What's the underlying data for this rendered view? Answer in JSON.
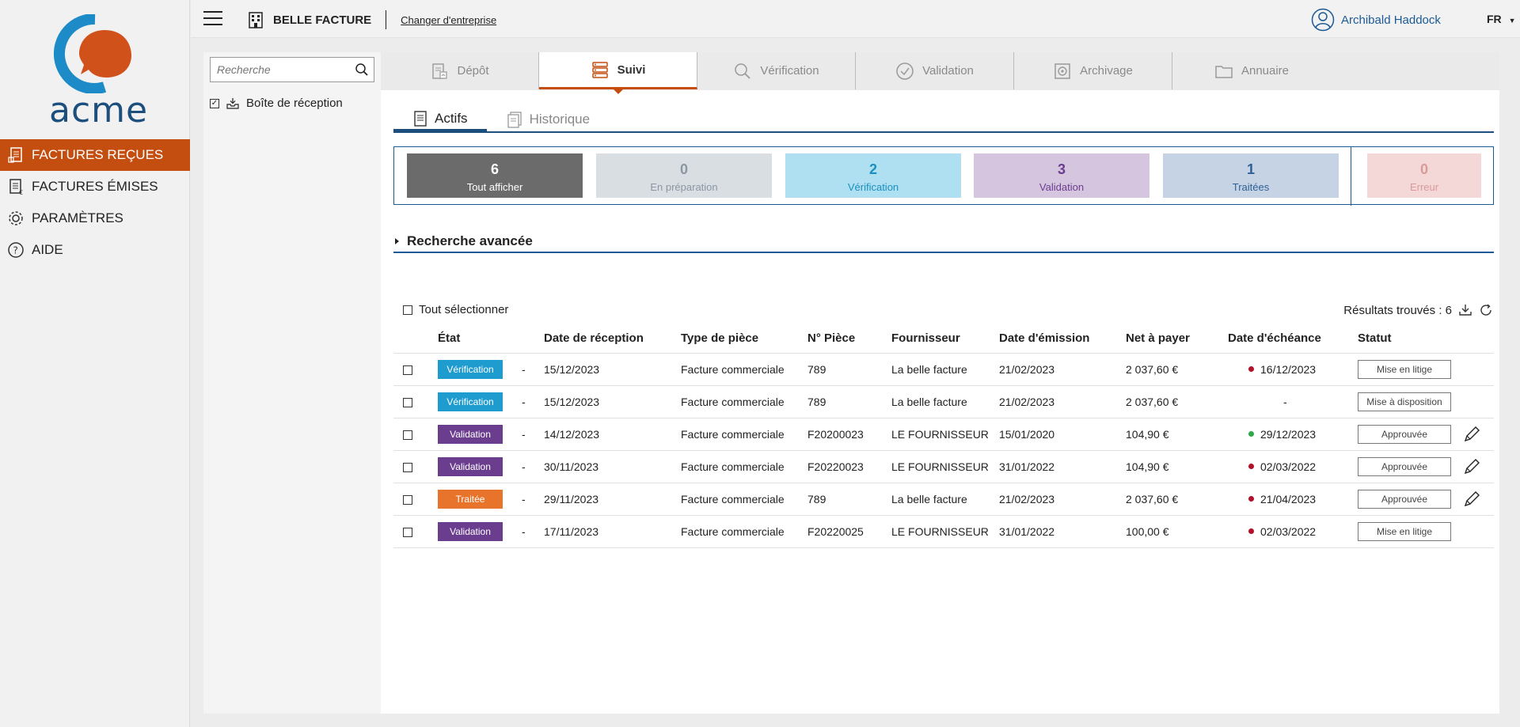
{
  "brand": {
    "logo_text": "acme"
  },
  "nav": {
    "items": [
      {
        "label": "FACTURES REÇUES",
        "icon": "invoice-received-icon",
        "active": true
      },
      {
        "label": "FACTURES ÉMISES",
        "icon": "invoice-sent-icon",
        "active": false
      },
      {
        "label": "PARAMÈTRES",
        "icon": "gear-icon",
        "active": false
      },
      {
        "label": "AIDE",
        "icon": "help-icon",
        "active": false
      }
    ]
  },
  "topbar": {
    "company": "BELLE FACTURE",
    "change_company": "Changer d'entreprise",
    "user": "Archibald Haddock",
    "lang": "FR"
  },
  "sidepanel": {
    "search_placeholder": "Recherche",
    "inbox_label": "Boîte de réception"
  },
  "main_tabs": [
    {
      "label": "Dépôt",
      "icon": "upload-doc-icon"
    },
    {
      "label": "Suivi",
      "icon": "list-icon",
      "active": true
    },
    {
      "label": "Vérification",
      "icon": "magnifier-icon"
    },
    {
      "label": "Validation",
      "icon": "check-circle-icon"
    },
    {
      "label": "Archivage",
      "icon": "safe-icon"
    },
    {
      "label": "Annuaire",
      "icon": "folder-icon"
    }
  ],
  "sub_tabs": [
    {
      "label": "Actifs",
      "active": true
    },
    {
      "label": "Historique",
      "active": false
    }
  ],
  "counters": [
    {
      "count": "6",
      "label": "Tout afficher",
      "bg": "#6b6b6b",
      "color": "#ffffff"
    },
    {
      "count": "0",
      "label": "En préparation",
      "bg": "#d9dee3",
      "color": "#8a97a3"
    },
    {
      "count": "2",
      "label": "Vérification",
      "bg": "#aee0f1",
      "color": "#1b8fc0"
    },
    {
      "count": "3",
      "label": "Validation",
      "bg": "#d6c5de",
      "color": "#6b3d8f"
    },
    {
      "count": "1",
      "label": "Traitées",
      "bg": "#c5d3e4",
      "color": "#2f5f96"
    },
    {
      "count": "0",
      "label": "Erreur",
      "bg": "#f4d8d8",
      "color": "#d99a9a"
    }
  ],
  "advanced_search": "Recherche avancée",
  "list": {
    "select_all": "Tout sélectionner",
    "results": "Résultats trouvés : 6"
  },
  "table": {
    "headers": [
      "État",
      "Date de réception",
      "Type de pièce",
      "N° Pièce",
      "Fournisseur",
      "Date d'émission",
      "Net à payer",
      "Date d'échéance",
      "Statut"
    ],
    "rows": [
      {
        "etat": "Vérification",
        "etat_color": "#1e9bcf",
        "separator": "-",
        "reception": "15/12/2023",
        "type": "Facture commerciale",
        "piece": "789",
        "fournisseur": "La belle facture",
        "emission": "21/02/2023",
        "net": "2 037,60 €",
        "echeance": "16/12/2023",
        "dot_color": "#b3102a",
        "statut": "Mise en litige",
        "editable": false
      },
      {
        "etat": "Vérification",
        "etat_color": "#1e9bcf",
        "separator": "-",
        "reception": "15/12/2023",
        "type": "Facture commerciale",
        "piece": "789",
        "fournisseur": "La belle facture",
        "emission": "21/02/2023",
        "net": "2 037,60 €",
        "echeance": "-",
        "dot_color": "",
        "statut": "Mise à disposition",
        "editable": false
      },
      {
        "etat": "Validation",
        "etat_color": "#6b3d8f",
        "separator": "-",
        "reception": "14/12/2023",
        "type": "Facture commerciale",
        "piece": "F20200023",
        "fournisseur": "LE FOURNISSEUR",
        "emission": "15/01/2020",
        "net": "104,90 €",
        "echeance": "29/12/2023",
        "dot_color": "#2ea84a",
        "statut": "Approuvée",
        "editable": true
      },
      {
        "etat": "Validation",
        "etat_color": "#6b3d8f",
        "separator": "-",
        "reception": "30/11/2023",
        "type": "Facture commerciale",
        "piece": "F20220023",
        "fournisseur": "LE FOURNISSEUR",
        "emission": "31/01/2022",
        "net": "104,90 €",
        "echeance": "02/03/2022",
        "dot_color": "#b3102a",
        "statut": "Approuvée",
        "editable": true
      },
      {
        "etat": "Traitée",
        "etat_color": "#e8732a",
        "separator": "-",
        "reception": "29/11/2023",
        "type": "Facture commerciale",
        "piece": "789",
        "fournisseur": "La belle facture",
        "emission": "21/02/2023",
        "net": "2 037,60 €",
        "echeance": "21/04/2023",
        "dot_color": "#b3102a",
        "statut": "Approuvée",
        "editable": true
      },
      {
        "etat": "Validation",
        "etat_color": "#6b3d8f",
        "separator": "-",
        "reception": "17/11/2023",
        "type": "Facture commerciale",
        "piece": "F20220025",
        "fournisseur": "LE FOURNISSEUR",
        "emission": "31/01/2022",
        "net": "100,00 €",
        "echeance": "02/03/2022",
        "dot_color": "#b3102a",
        "statut": "Mise en litige",
        "editable": false
      }
    ]
  }
}
